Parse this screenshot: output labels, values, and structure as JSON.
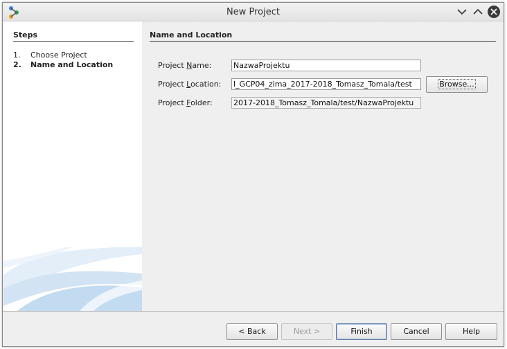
{
  "window": {
    "title": "New Project",
    "controls": [
      "chevron-down-icon",
      "chevron-up-icon",
      "close-icon"
    ]
  },
  "steps": {
    "title": "Steps",
    "items": [
      {
        "number": "1.",
        "label": "Choose Project",
        "current": false
      },
      {
        "number": "2.",
        "label": "Name and Location",
        "current": true
      }
    ]
  },
  "panel": {
    "title": "Name and Location",
    "fields": {
      "name": {
        "label": "Project Name:",
        "value": "NazwaProjektu"
      },
      "location": {
        "label": "Project Location:",
        "value": "l_GCP04_zima_2017-2018_Tomasz_Tomala/test"
      },
      "folder": {
        "label": "Project Folder:",
        "value": "2017-2018_Tomasz_Tomala/test/NazwaProjektu"
      }
    },
    "browse_label": "Browse..."
  },
  "buttons": {
    "back": "< Back",
    "next": "Next >",
    "finish": "Finish",
    "cancel": "Cancel",
    "help": "Help"
  },
  "colors": {
    "dialog_bg": "#efefef",
    "left_pane_bg": "#ffffff",
    "default_button_border": "#5c7aa3",
    "close_button": "#3a3a3a"
  }
}
